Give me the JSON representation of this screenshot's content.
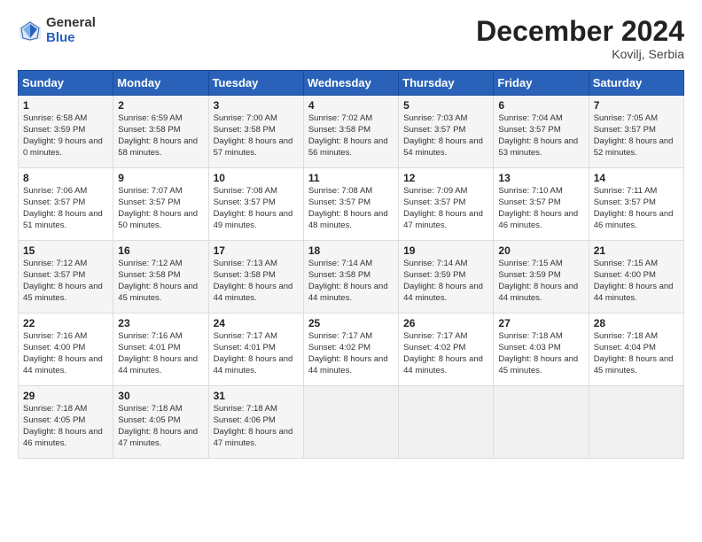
{
  "header": {
    "logo_general": "General",
    "logo_blue": "Blue",
    "month_title": "December 2024",
    "location": "Kovilj, Serbia"
  },
  "weekdays": [
    "Sunday",
    "Monday",
    "Tuesday",
    "Wednesday",
    "Thursday",
    "Friday",
    "Saturday"
  ],
  "weeks": [
    [
      {
        "day": "1",
        "sunrise": "Sunrise: 6:58 AM",
        "sunset": "Sunset: 3:59 PM",
        "daylight": "Daylight: 9 hours and 0 minutes."
      },
      {
        "day": "2",
        "sunrise": "Sunrise: 6:59 AM",
        "sunset": "Sunset: 3:58 PM",
        "daylight": "Daylight: 8 hours and 58 minutes."
      },
      {
        "day": "3",
        "sunrise": "Sunrise: 7:00 AM",
        "sunset": "Sunset: 3:58 PM",
        "daylight": "Daylight: 8 hours and 57 minutes."
      },
      {
        "day": "4",
        "sunrise": "Sunrise: 7:02 AM",
        "sunset": "Sunset: 3:58 PM",
        "daylight": "Daylight: 8 hours and 56 minutes."
      },
      {
        "day": "5",
        "sunrise": "Sunrise: 7:03 AM",
        "sunset": "Sunset: 3:57 PM",
        "daylight": "Daylight: 8 hours and 54 minutes."
      },
      {
        "day": "6",
        "sunrise": "Sunrise: 7:04 AM",
        "sunset": "Sunset: 3:57 PM",
        "daylight": "Daylight: 8 hours and 53 minutes."
      },
      {
        "day": "7",
        "sunrise": "Sunrise: 7:05 AM",
        "sunset": "Sunset: 3:57 PM",
        "daylight": "Daylight: 8 hours and 52 minutes."
      }
    ],
    [
      {
        "day": "8",
        "sunrise": "Sunrise: 7:06 AM",
        "sunset": "Sunset: 3:57 PM",
        "daylight": "Daylight: 8 hours and 51 minutes."
      },
      {
        "day": "9",
        "sunrise": "Sunrise: 7:07 AM",
        "sunset": "Sunset: 3:57 PM",
        "daylight": "Daylight: 8 hours and 50 minutes."
      },
      {
        "day": "10",
        "sunrise": "Sunrise: 7:08 AM",
        "sunset": "Sunset: 3:57 PM",
        "daylight": "Daylight: 8 hours and 49 minutes."
      },
      {
        "day": "11",
        "sunrise": "Sunrise: 7:08 AM",
        "sunset": "Sunset: 3:57 PM",
        "daylight": "Daylight: 8 hours and 48 minutes."
      },
      {
        "day": "12",
        "sunrise": "Sunrise: 7:09 AM",
        "sunset": "Sunset: 3:57 PM",
        "daylight": "Daylight: 8 hours and 47 minutes."
      },
      {
        "day": "13",
        "sunrise": "Sunrise: 7:10 AM",
        "sunset": "Sunset: 3:57 PM",
        "daylight": "Daylight: 8 hours and 46 minutes."
      },
      {
        "day": "14",
        "sunrise": "Sunrise: 7:11 AM",
        "sunset": "Sunset: 3:57 PM",
        "daylight": "Daylight: 8 hours and 46 minutes."
      }
    ],
    [
      {
        "day": "15",
        "sunrise": "Sunrise: 7:12 AM",
        "sunset": "Sunset: 3:57 PM",
        "daylight": "Daylight: 8 hours and 45 minutes."
      },
      {
        "day": "16",
        "sunrise": "Sunrise: 7:12 AM",
        "sunset": "Sunset: 3:58 PM",
        "daylight": "Daylight: 8 hours and 45 minutes."
      },
      {
        "day": "17",
        "sunrise": "Sunrise: 7:13 AM",
        "sunset": "Sunset: 3:58 PM",
        "daylight": "Daylight: 8 hours and 44 minutes."
      },
      {
        "day": "18",
        "sunrise": "Sunrise: 7:14 AM",
        "sunset": "Sunset: 3:58 PM",
        "daylight": "Daylight: 8 hours and 44 minutes."
      },
      {
        "day": "19",
        "sunrise": "Sunrise: 7:14 AM",
        "sunset": "Sunset: 3:59 PM",
        "daylight": "Daylight: 8 hours and 44 minutes."
      },
      {
        "day": "20",
        "sunrise": "Sunrise: 7:15 AM",
        "sunset": "Sunset: 3:59 PM",
        "daylight": "Daylight: 8 hours and 44 minutes."
      },
      {
        "day": "21",
        "sunrise": "Sunrise: 7:15 AM",
        "sunset": "Sunset: 4:00 PM",
        "daylight": "Daylight: 8 hours and 44 minutes."
      }
    ],
    [
      {
        "day": "22",
        "sunrise": "Sunrise: 7:16 AM",
        "sunset": "Sunset: 4:00 PM",
        "daylight": "Daylight: 8 hours and 44 minutes."
      },
      {
        "day": "23",
        "sunrise": "Sunrise: 7:16 AM",
        "sunset": "Sunset: 4:01 PM",
        "daylight": "Daylight: 8 hours and 44 minutes."
      },
      {
        "day": "24",
        "sunrise": "Sunrise: 7:17 AM",
        "sunset": "Sunset: 4:01 PM",
        "daylight": "Daylight: 8 hours and 44 minutes."
      },
      {
        "day": "25",
        "sunrise": "Sunrise: 7:17 AM",
        "sunset": "Sunset: 4:02 PM",
        "daylight": "Daylight: 8 hours and 44 minutes."
      },
      {
        "day": "26",
        "sunrise": "Sunrise: 7:17 AM",
        "sunset": "Sunset: 4:02 PM",
        "daylight": "Daylight: 8 hours and 44 minutes."
      },
      {
        "day": "27",
        "sunrise": "Sunrise: 7:18 AM",
        "sunset": "Sunset: 4:03 PM",
        "daylight": "Daylight: 8 hours and 45 minutes."
      },
      {
        "day": "28",
        "sunrise": "Sunrise: 7:18 AM",
        "sunset": "Sunset: 4:04 PM",
        "daylight": "Daylight: 8 hours and 45 minutes."
      }
    ],
    [
      {
        "day": "29",
        "sunrise": "Sunrise: 7:18 AM",
        "sunset": "Sunset: 4:05 PM",
        "daylight": "Daylight: 8 hours and 46 minutes."
      },
      {
        "day": "30",
        "sunrise": "Sunrise: 7:18 AM",
        "sunset": "Sunset: 4:05 PM",
        "daylight": "Daylight: 8 hours and 47 minutes."
      },
      {
        "day": "31",
        "sunrise": "Sunrise: 7:18 AM",
        "sunset": "Sunset: 4:06 PM",
        "daylight": "Daylight: 8 hours and 47 minutes."
      },
      null,
      null,
      null,
      null
    ]
  ]
}
